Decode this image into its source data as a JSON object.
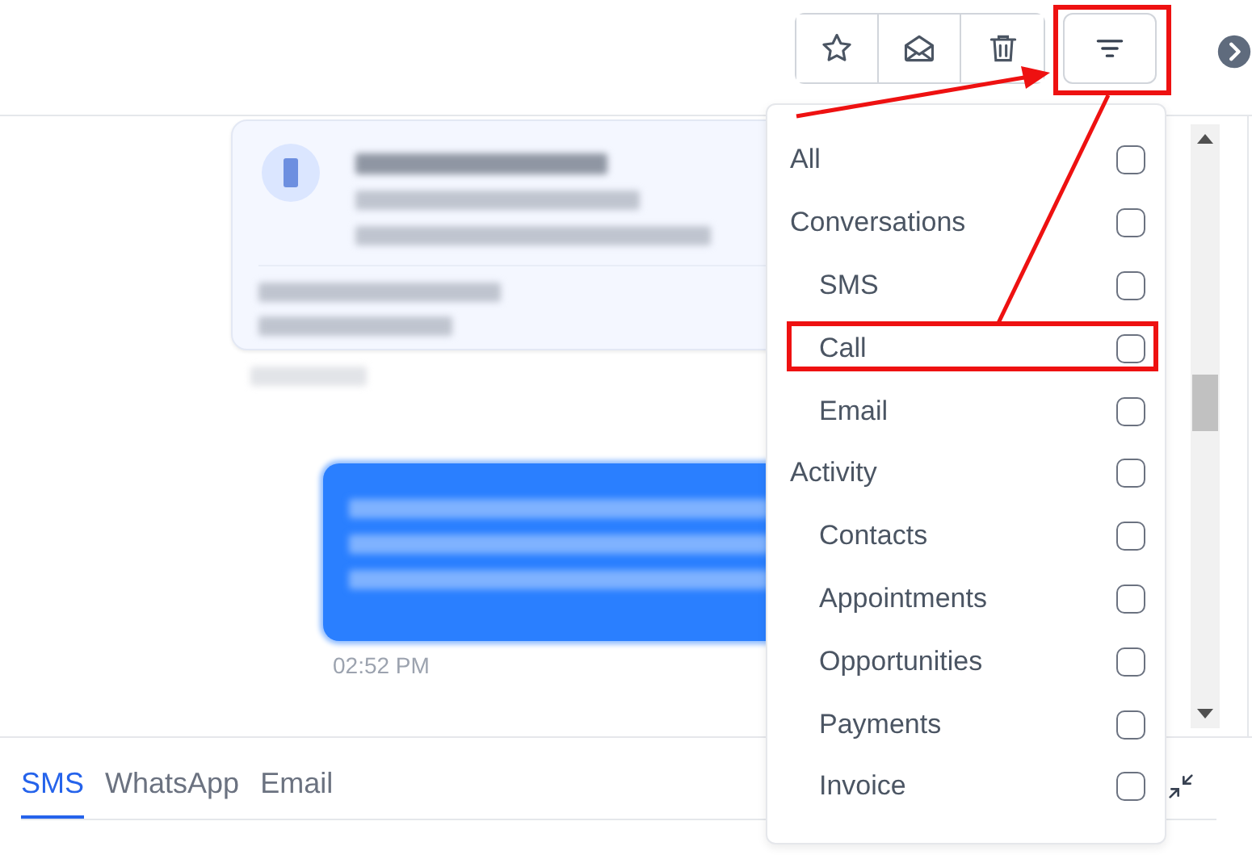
{
  "toolbar": {
    "buttons": [
      {
        "kind": "star"
      },
      {
        "kind": "envelope"
      },
      {
        "kind": "trash"
      }
    ],
    "filter_button": {
      "highlighted": true
    }
  },
  "messages": [
    {
      "kind": "payment-card"
    },
    {
      "kind": "outgoing",
      "time": "02:52 PM"
    }
  ],
  "filter_menu": {
    "items": [
      {
        "label": "All",
        "checked": false,
        "highlighted": false
      },
      {
        "label": "Conversations",
        "checked": false,
        "highlighted": false,
        "children": [
          {
            "label": "SMS",
            "checked": false,
            "highlighted": false
          },
          {
            "label": "Call",
            "checked": false,
            "highlighted": true
          },
          {
            "label": "Email",
            "checked": false,
            "highlighted": false
          }
        ]
      },
      {
        "label": "Activity",
        "checked": false,
        "highlighted": false,
        "children": [
          {
            "label": "Contacts",
            "checked": false,
            "highlighted": false
          },
          {
            "label": "Appointments",
            "checked": false,
            "highlighted": false
          },
          {
            "label": "Opportunities",
            "checked": false,
            "highlighted": false
          },
          {
            "label": "Payments",
            "checked": false,
            "highlighted": false
          },
          {
            "label": "Invoice",
            "checked": false,
            "highlighted": false
          }
        ]
      }
    ]
  },
  "compose_tabs": [
    {
      "label": "SMS",
      "selected": true
    },
    {
      "label": "WhatsApp",
      "selected": false
    },
    {
      "label": "Email",
      "selected": false
    }
  ]
}
